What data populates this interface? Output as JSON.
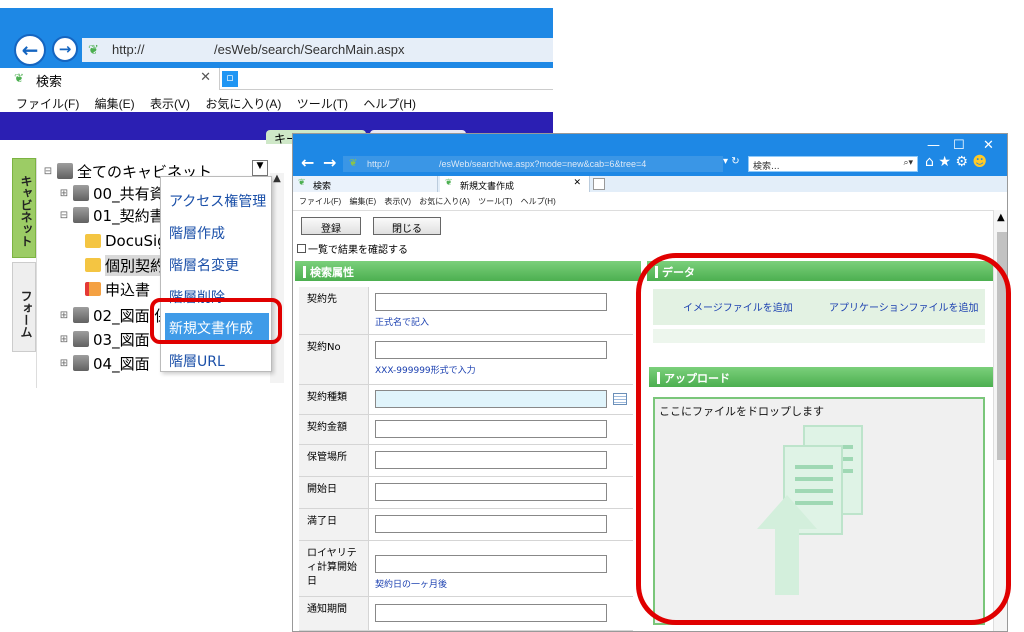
{
  "back_window": {
    "url": "http://                         /esWeb/search/SearchMain.aspx",
    "url_left": "http://",
    "url_right": "/esWeb/search/SearchMain.aspx",
    "tab_title": "検索",
    "menu": [
      "ファイル(F)",
      "編集(E)",
      "表示(V)",
      "お気に入り(A)",
      "ツール(T)",
      "ヘルプ(H)"
    ],
    "banner_tab": "キー",
    "side_tabs": [
      "キャビネット",
      "フォーム"
    ],
    "tree": {
      "root": "全てのキャビネット",
      "items": [
        "00_共有資",
        "01_契約書",
        "DocuSig",
        "個別契約",
        "申込書",
        "02_図面 保",
        "03_図面",
        "04_図面"
      ]
    },
    "context_menu": [
      "アクセス権管理",
      "階層作成",
      "階層名変更",
      "階層削除",
      "新規文書作成",
      "階層URL"
    ]
  },
  "front_window": {
    "url_left": "http://",
    "url_right": "/esWeb/search/we.aspx?mode=new&cab=6&tree=4",
    "search_placeholder": "検索...",
    "tabs": [
      "検索",
      "新規文書作成"
    ],
    "menu": [
      "ファイル(F)",
      "編集(E)",
      "表示(V)",
      "お気に入り(A)",
      "ツール(T)",
      "ヘルプ(H)"
    ],
    "buttons": {
      "register": "登録",
      "close": "閉じる"
    },
    "confirm_checkbox": "一覧で結果を確認する",
    "search_attr_header": "検索属性",
    "data_header": "データ",
    "upload_header": "アップロード",
    "add_image": "イメージファイルを追加",
    "add_app": "アプリケーションファイルを追加",
    "drop_text": "ここにファイルをドロップします",
    "fields": [
      {
        "label": "契約先",
        "hint": "正式名で記入"
      },
      {
        "label": "契約No",
        "hint": "XXX-999999形式で入力"
      },
      {
        "label": "契約種類",
        "hint": ""
      },
      {
        "label": "契約金額",
        "hint": ""
      },
      {
        "label": "保管場所",
        "hint": ""
      },
      {
        "label": "開始日",
        "hint": ""
      },
      {
        "label": "満了日",
        "hint": ""
      },
      {
        "label": "ロイヤリティ計算開始日",
        "hint": "契約日の一ヶ月後"
      },
      {
        "label": "通知期間",
        "hint": ""
      }
    ]
  },
  "colors": {
    "ie_blue": "#1e88e5",
    "green_header": "#4caf50",
    "highlight_red": "#e00000",
    "menu_highlight": "#3f9be8"
  }
}
